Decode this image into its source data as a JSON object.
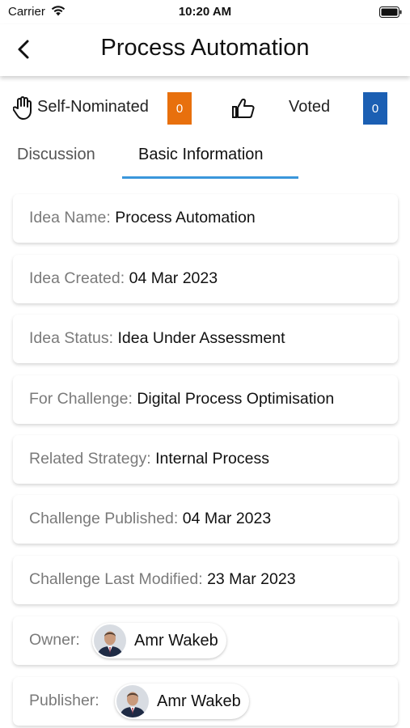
{
  "status_bar": {
    "carrier": "Carrier",
    "time": "10:20 AM"
  },
  "header": {
    "title": "Process Automation"
  },
  "stats": {
    "self_nominated_label": "Self-Nominated",
    "self_nominated_count": "0",
    "voted_label": "Voted",
    "voted_count": "0",
    "colors": {
      "self_nominated_badge": "#e8700d",
      "voted_badge": "#1b5fb3"
    }
  },
  "tabs": {
    "items": [
      {
        "label": "Discussion"
      },
      {
        "label": "Basic Information"
      }
    ],
    "active_index": 1,
    "accent": "#3a97db"
  },
  "info": [
    {
      "label": "Idea Name:",
      "value": "Process Automation"
    },
    {
      "label": "Idea Created:",
      "value": "04 Mar 2023"
    },
    {
      "label": "Idea Status:",
      "value": "Idea Under Assessment"
    },
    {
      "label": "For Challenge:",
      "value": "Digital Process Optimisation"
    },
    {
      "label": "Related Strategy:",
      "value": "Internal Process"
    },
    {
      "label": "Challenge Published:",
      "value": "04 Mar 2023"
    },
    {
      "label": "Challenge Last Modified:",
      "value": "23 Mar 2023"
    }
  ],
  "people": {
    "owner": {
      "label": "Owner:",
      "name": "Amr Wakeb"
    },
    "publisher": {
      "label": "Publisher:",
      "name": "Amr Wakeb"
    }
  },
  "icons": [
    "wifi-icon",
    "battery-icon",
    "back-arrow-icon",
    "raised-hand-icon",
    "thumbs-up-icon",
    "avatar"
  ]
}
